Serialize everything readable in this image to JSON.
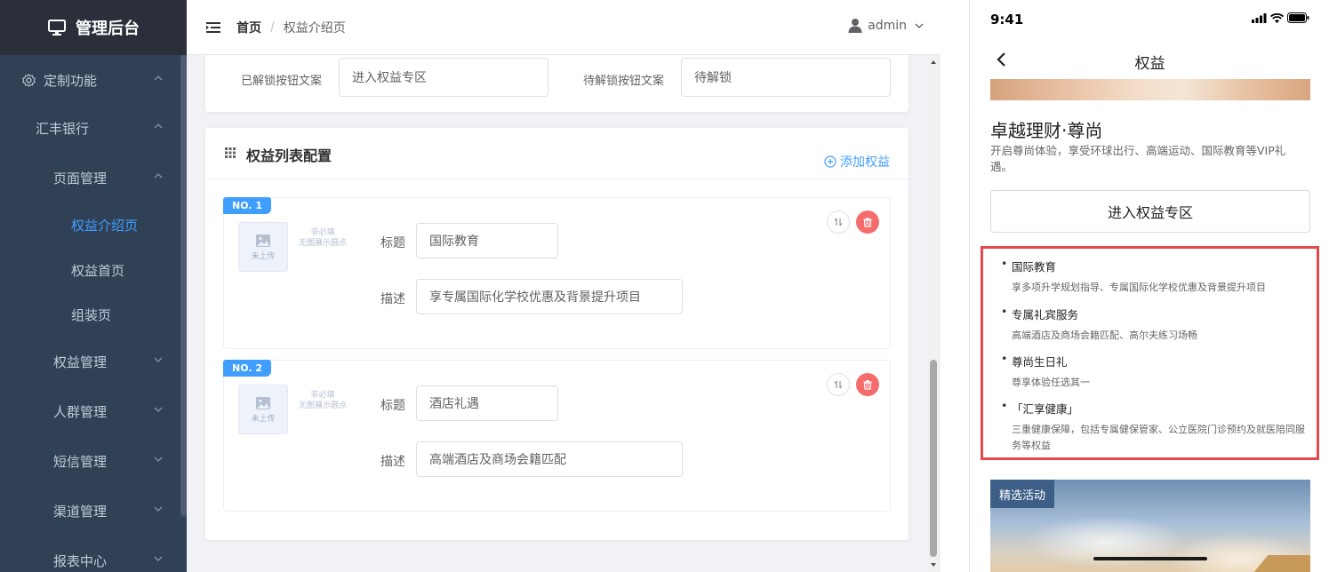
{
  "sidebar": {
    "logo_text": "管理后台",
    "items": [
      {
        "label": "定制功能"
      },
      {
        "label": "汇丰银行"
      },
      {
        "label": "页面管理"
      },
      {
        "label": "权益介绍页"
      },
      {
        "label": "权益首页"
      },
      {
        "label": "组装页"
      },
      {
        "label": "权益管理"
      },
      {
        "label": "人群管理"
      },
      {
        "label": "短信管理"
      },
      {
        "label": "渠道管理"
      },
      {
        "label": "报表中心"
      }
    ]
  },
  "header": {
    "breadcrumb_home": "首页",
    "breadcrumb_sep": "/",
    "breadcrumb_current": "权益介绍页",
    "user": "admin"
  },
  "top_card": {
    "unlocked_label": "已解锁按钮文案",
    "unlocked_value": "进入权益专区",
    "locked_label": "待解锁按钮文案",
    "locked_value": "待解锁"
  },
  "list_config": {
    "title": "权益列表配置",
    "add_label": "添加权益",
    "items": [
      {
        "tag": "NO. 1",
        "upload_text": "未上传",
        "note_line1": "非必填",
        "note_line2": "无图展示圆点",
        "title_label": "标题",
        "title_value": "国际教育",
        "desc_label": "描述",
        "desc_value": "享专属国际化学校优惠及背景提升项目"
      },
      {
        "tag": "NO. 2",
        "upload_text": "未上传",
        "note_line1": "非必填",
        "note_line2": "无图展示圆点",
        "title_label": "标题",
        "title_value": "酒店礼遇",
        "desc_label": "描述",
        "desc_value": "高端酒店及商场会籍匹配"
      }
    ]
  },
  "phone": {
    "time": "9:41",
    "nav_title": "权益",
    "title": "卓越理财·尊尚",
    "subtitle": "开启尊尚体验，享受环球出行、高端运动、国际教育等VIP礼遇。",
    "button": "进入权益专区",
    "benefits": [
      {
        "title": "国际教育",
        "desc": "享多项升学规划指导、专属国际化学校优惠及背景提升项目"
      },
      {
        "title": "专属礼宾服务",
        "desc": "高端酒店及商场会籍匹配、高尔夫练习场畅"
      },
      {
        "title": "尊尚生日礼",
        "desc": "尊享体验任选其一"
      },
      {
        "title": "「汇享健康」",
        "desc": "三重健康保障，包括专属健保管家、公立医院门诊预约及就医陪同服务等权益"
      }
    ],
    "activity_tag": "精选活动"
  },
  "colors": {
    "sidebar_bg": "#304156",
    "accent": "#409eff",
    "danger": "#f56c6c",
    "highlight_frame": "#e5484d"
  }
}
